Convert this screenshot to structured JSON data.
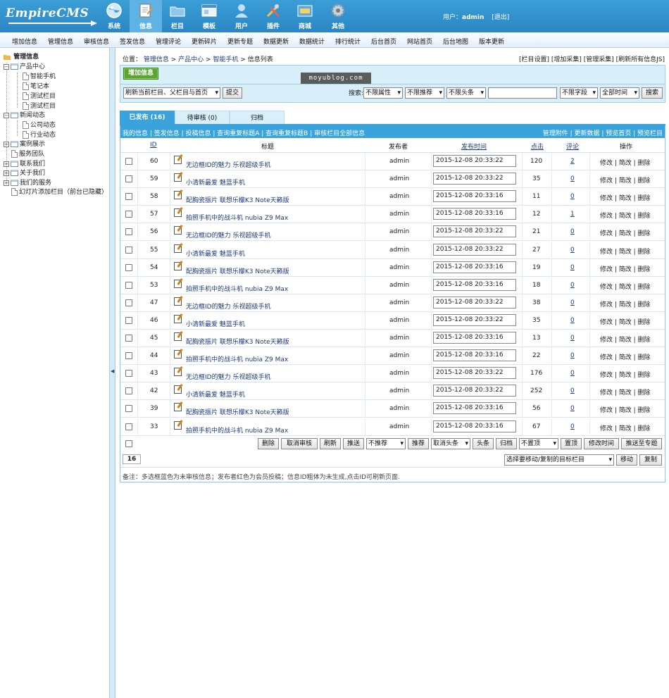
{
  "header": {
    "logo": "EmpireCMS",
    "nav": [
      {
        "label": "系统",
        "icon": "globe-icon"
      },
      {
        "label": "信息",
        "icon": "document-icon"
      },
      {
        "label": "栏目",
        "icon": "folder-icon"
      },
      {
        "label": "模板",
        "icon": "window-icon"
      },
      {
        "label": "用户",
        "icon": "user-icon"
      },
      {
        "label": "插件",
        "icon": "tools-icon"
      },
      {
        "label": "商城",
        "icon": "shop-icon"
      },
      {
        "label": "其他",
        "icon": "gear-icon"
      }
    ],
    "active_nav": "信息",
    "user_label": "用户：",
    "username": "admin",
    "logout": "[退出]"
  },
  "menu": [
    "增加信息",
    "管理信息",
    "审核信息",
    "签发信息",
    "管理评论",
    "更新碎片",
    "更新专题",
    "数据更新",
    "数据统计",
    "排行统计",
    "后台首页",
    "网站首页",
    "后台地图",
    "版本更新"
  ],
  "sidebar": {
    "root": "管理信息",
    "items": [
      {
        "label": "产品中心"
      },
      {
        "label": "智能手机"
      },
      {
        "label": "笔记本"
      },
      {
        "label": "测试栏目"
      },
      {
        "label": "测试栏目"
      },
      {
        "label": "新闻动态"
      },
      {
        "label": "公司动态"
      },
      {
        "label": "行业动态"
      },
      {
        "label": "案例展示"
      },
      {
        "label": "服务团队"
      },
      {
        "label": "联系我们"
      },
      {
        "label": "关于我们"
      },
      {
        "label": "我们的服务"
      },
      {
        "label": "幻灯片添加栏目（前台已隐藏）"
      }
    ]
  },
  "location": {
    "prefix": "位置：",
    "crumbs": [
      "管理信息",
      "产品中心",
      "智能手机"
    ],
    "current": "信息列表",
    "sep": " > "
  },
  "top_links": "[栏目设置] [增加采集] [管理采集] [刷新所有信息JS]",
  "panel": {
    "add_button": "增加信息",
    "watermark": "moyublog.com",
    "refresh_select": "刷新当前栏目、父栏目与首页",
    "submit": "提交",
    "search_label": "搜索:",
    "attr_select": "不限属性",
    "recommend_select": "不限推荐",
    "headline_select": "不限头条",
    "search_value": "",
    "field_select": "不限字段",
    "time_select": "全部时间",
    "search_button": "搜索"
  },
  "tabs": [
    {
      "label": "已发布 (16)",
      "active": true
    },
    {
      "label": "待审核 (0)",
      "active": false
    },
    {
      "label": "归档",
      "active": false
    }
  ],
  "sublinks_left": "我的信息 | 签发信息 | 投稿信息 | 查询重复标题A | 查询重复标题B | 审核栏目全部信息",
  "sublinks_right": "管理附件 | 更新数据 | 预览首页 | 预览栏目",
  "table": {
    "headers": {
      "id": "ID",
      "title": "标题",
      "publisher": "发布者",
      "time": "发布时间",
      "hits": "点击",
      "comments": "评论",
      "ops": "操作"
    },
    "ops_label": "修改 | 简改 | 删除",
    "rows": [
      {
        "id": "60",
        "title": "无边框ID的魅力 乐视超级手机",
        "publisher": "admin",
        "time": "2015-12-08 20:33:22",
        "hits": "120",
        "comments": "2"
      },
      {
        "id": "59",
        "title": "小清新最爱 魅蓝手机",
        "publisher": "admin",
        "time": "2015-12-08 20:33:22",
        "hits": "35",
        "comments": "0"
      },
      {
        "id": "58",
        "title": "配胸瓷振片 联想乐檬K3 Note天籁版",
        "publisher": "admin",
        "time": "2015-12-08 20:33:16",
        "hits": "11",
        "comments": "0"
      },
      {
        "id": "57",
        "title": "拍照手机中的战斗机 nubia Z9 Max",
        "publisher": "admin",
        "time": "2015-12-08 20:33:16",
        "hits": "12",
        "comments": "1"
      },
      {
        "id": "56",
        "title": "无边框ID的魅力 乐视超级手机",
        "publisher": "admin",
        "time": "2015-12-08 20:33:22",
        "hits": "21",
        "comments": "0"
      },
      {
        "id": "55",
        "title": "小清新最爱 魅蓝手机",
        "publisher": "admin",
        "time": "2015-12-08 20:33:22",
        "hits": "27",
        "comments": "0"
      },
      {
        "id": "54",
        "title": "配胸瓷振片 联想乐檬K3 Note天籁版",
        "publisher": "admin",
        "time": "2015-12-08 20:33:16",
        "hits": "19",
        "comments": "0"
      },
      {
        "id": "53",
        "title": "拍照手机中的战斗机 nubia Z9 Max",
        "publisher": "admin",
        "time": "2015-12-08 20:33:16",
        "hits": "18",
        "comments": "0"
      },
      {
        "id": "47",
        "title": "无边框ID的魅力 乐视超级手机",
        "publisher": "admin",
        "time": "2015-12-08 20:33:22",
        "hits": "38",
        "comments": "0"
      },
      {
        "id": "46",
        "title": "小清新最爱 魅蓝手机",
        "publisher": "admin",
        "time": "2015-12-08 20:33:22",
        "hits": "35",
        "comments": "0"
      },
      {
        "id": "45",
        "title": "配胸瓷振片 联想乐檬K3 Note天籁版",
        "publisher": "admin",
        "time": "2015-12-08 20:33:16",
        "hits": "13",
        "comments": "0"
      },
      {
        "id": "44",
        "title": "拍照手机中的战斗机 nubia Z9 Max",
        "publisher": "admin",
        "time": "2015-12-08 20:33:16",
        "hits": "22",
        "comments": "0"
      },
      {
        "id": "43",
        "title": "无边框ID的魅力 乐视超级手机",
        "publisher": "admin",
        "time": "2015-12-08 20:33:22",
        "hits": "176",
        "comments": "0"
      },
      {
        "id": "42",
        "title": "小清新最爱 魅蓝手机",
        "publisher": "admin",
        "time": "2015-12-08 20:33:22",
        "hits": "252",
        "comments": "0"
      },
      {
        "id": "39",
        "title": "配胸瓷振片 联想乐檬K3 Note天籁版",
        "publisher": "admin",
        "time": "2015-12-08 20:33:16",
        "hits": "56",
        "comments": "0"
      },
      {
        "id": "33",
        "title": "拍照手机中的战斗机 nubia Z9 Max",
        "publisher": "admin",
        "time": "2015-12-08 20:33:16",
        "hits": "67",
        "comments": "0"
      }
    ]
  },
  "actions": {
    "delete": "删除",
    "cancel_review": "取消审核",
    "refresh": "刷新",
    "push": "推送",
    "not_recommend": "不推荐",
    "recommend": "推荐",
    "cancel_headline": "取消头条",
    "headline": "头条",
    "archive": "归档",
    "not_top": "不置顶",
    "set_top": "置顶",
    "edit_time": "修改时间",
    "push_topic": "推送至专题"
  },
  "count": "16",
  "move_select": "选择要移动/复制的目标栏目",
  "move": "移动",
  "copy": "复制",
  "note": "备注：多选框蓝色为未审核信息；发布者红色为会员投稿；信息ID粗体为未生成,点击ID可刷新页面.",
  "colors": {
    "header_blue": "#2a86c4",
    "tab_blue": "#3aa3dc",
    "add_green": "#5aa532"
  }
}
